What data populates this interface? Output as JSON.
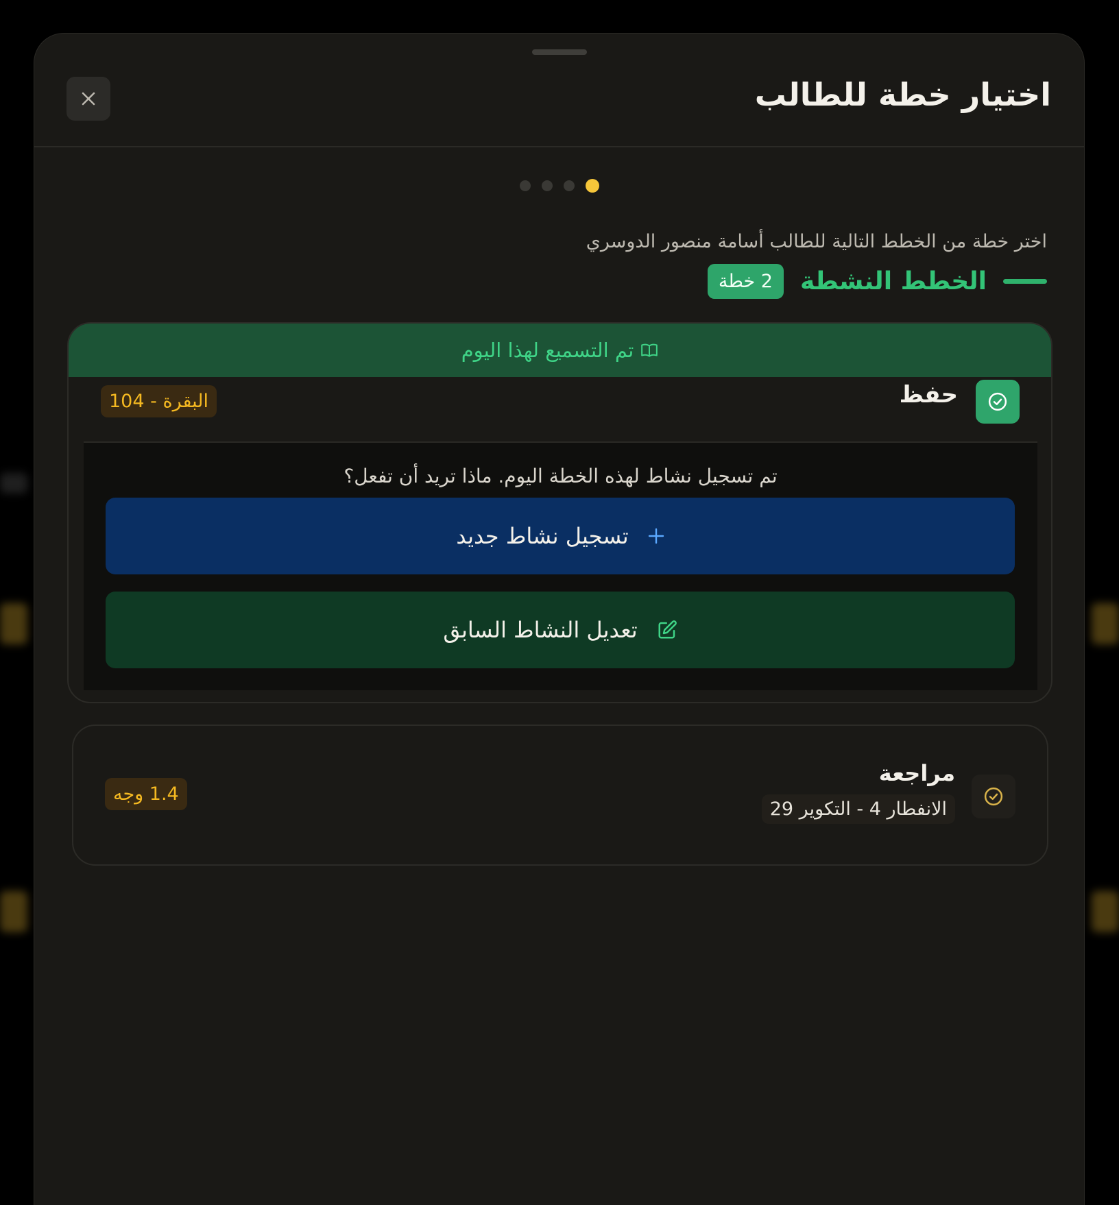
{
  "modal": {
    "title": "اختيار خطة للطالب",
    "close_icon": "close-icon"
  },
  "stepper": {
    "total_steps": 4,
    "current_step": 4
  },
  "intro": {
    "subtitle": "اختر خطة من الخطط التالية للطالب أسامة منصور الدوسري"
  },
  "section": {
    "title": "الخطط النشطة",
    "count_label": "2 خطة"
  },
  "plan_card": {
    "banner_text": "تم التسميع لهذا اليوم",
    "banner_icon": "book-icon",
    "plan_name": "حفظ",
    "plan_icon": "check-circle-icon",
    "reference": "البقرة - 104",
    "message": "تم تسجيل نشاط لهذه الخطة اليوم. ماذا تريد أن تفعل؟",
    "new_activity_label": "تسجيل نشاط جديد",
    "new_activity_icon": "plus-icon",
    "edit_activity_label": "تعديل النشاط السابق",
    "edit_activity_icon": "edit-icon"
  },
  "review_card": {
    "plan_name": "مراجعة",
    "range": "الانفطار 4 - التكوير 29",
    "pages": "1.4 وجه",
    "icon": "check-circle-icon"
  },
  "colors": {
    "accent_green": "#33c477",
    "accent_yellow": "#f6c63a",
    "button_blue": "#0a2f63",
    "button_green": "#0f3a24"
  }
}
